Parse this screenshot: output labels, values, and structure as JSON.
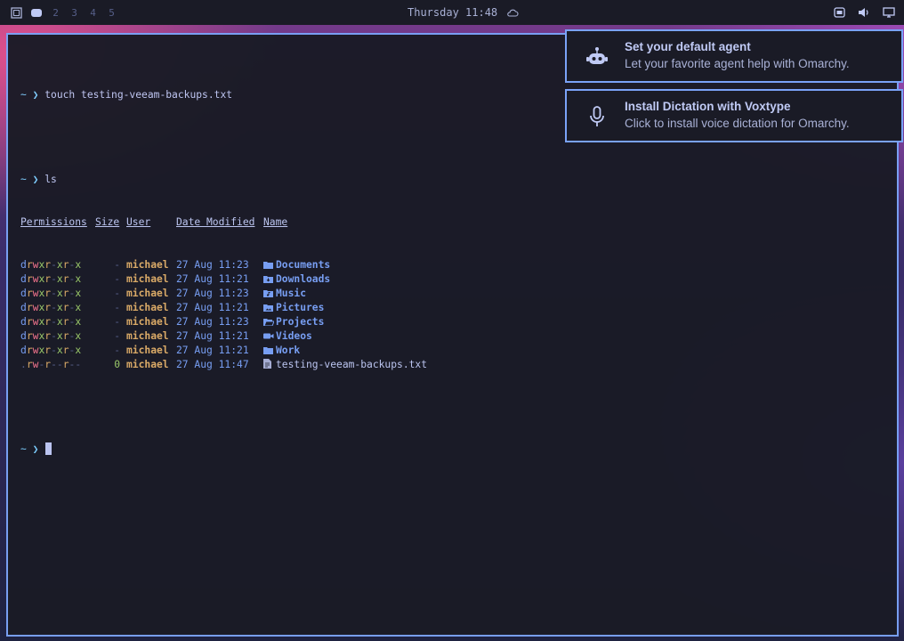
{
  "topbar": {
    "workspaces": [
      "2",
      "3",
      "4",
      "5"
    ],
    "clock": "Thursday 11:48",
    "icons": [
      "omarchy-menu-icon",
      "workspace-1-active",
      "weather-cloud-icon",
      "bluetooth-icon",
      "volume-icon",
      "display-icon"
    ]
  },
  "terminal": {
    "cmd1": {
      "prompt": "~ ❯",
      "command": "touch testing-veeam-backups.txt"
    },
    "cmd2": {
      "prompt": "~ ❯",
      "command": "ls"
    },
    "headers": {
      "permissions": "Permissions",
      "size": "Size",
      "user": "User",
      "date": "Date Modified",
      "name": "Name"
    },
    "rows": [
      {
        "perm": "drwxr-xr-x",
        "size": "-",
        "user": "michael",
        "date": "27 Aug 11:23",
        "name": "Documents",
        "icon": "folder-icon"
      },
      {
        "perm": "drwxr-xr-x",
        "size": "-",
        "user": "michael",
        "date": "27 Aug 11:21",
        "name": "Downloads",
        "icon": "folder-download-icon"
      },
      {
        "perm": "drwxr-xr-x",
        "size": "-",
        "user": "michael",
        "date": "27 Aug 11:23",
        "name": "Music",
        "icon": "folder-music-icon"
      },
      {
        "perm": "drwxr-xr-x",
        "size": "-",
        "user": "michael",
        "date": "27 Aug 11:21",
        "name": "Pictures",
        "icon": "folder-image-icon"
      },
      {
        "perm": "drwxr-xr-x",
        "size": "-",
        "user": "michael",
        "date": "27 Aug 11:23",
        "name": "Projects",
        "icon": "folder-open-icon"
      },
      {
        "perm": "drwxr-xr-x",
        "size": "-",
        "user": "michael",
        "date": "27 Aug 11:21",
        "name": "Videos",
        "icon": "video-icon"
      },
      {
        "perm": "drwxr-xr-x",
        "size": "-",
        "user": "michael",
        "date": "27 Aug 11:21",
        "name": "Work",
        "icon": "folder-icon"
      },
      {
        "perm": ".rw-r--r--",
        "size": "0",
        "user": "michael",
        "date": "27 Aug 11:47",
        "name": "testing-veeam-backups.txt",
        "icon": "file-text-icon"
      }
    ],
    "cmd3": {
      "prompt": "~ ❯"
    }
  },
  "notifications": [
    {
      "title": "Set your default agent",
      "body": "Let your favorite agent help with Omarchy.",
      "icon": "robot-icon"
    },
    {
      "title": "Install Dictation with Voxtype",
      "body": "Click to install voice dictation for Omarchy.",
      "icon": "microphone-icon"
    }
  ],
  "colors": {
    "accent": "#7aa2f7",
    "background": "#1a1b26",
    "user": "#e0af68",
    "exec": "#9ece6a",
    "write": "#f7768e"
  }
}
